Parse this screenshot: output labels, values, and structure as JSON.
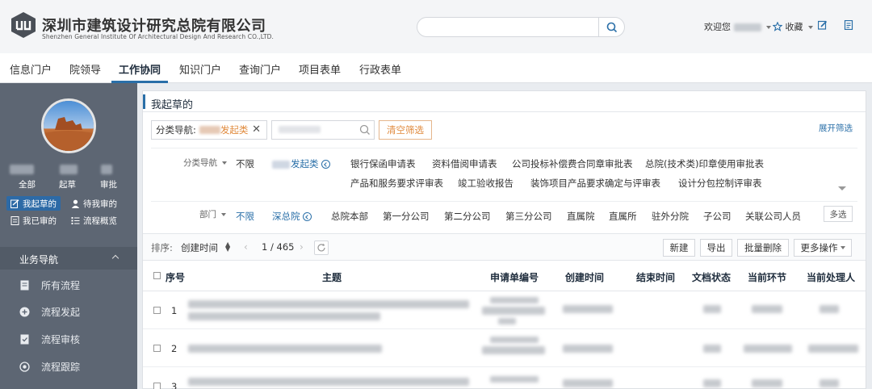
{
  "header": {
    "org_name_cn": "深圳市建筑设计研究总院有限公司",
    "org_name_en": "Shenzhen General Institute Of Architectural Design And Research CO.,LTD.",
    "welcome": "欢迎您",
    "favorites": "收藏"
  },
  "nav": {
    "items": [
      "信息门户",
      "院领导",
      "工作协同",
      "知识门户",
      "查询门户",
      "项目表单",
      "行政表单"
    ],
    "active": "工作协同"
  },
  "sidebar": {
    "stats": [
      {
        "label": "全部"
      },
      {
        "label": "起草"
      },
      {
        "label": "审批"
      }
    ],
    "quick": [
      {
        "label": "我起草的",
        "active": true
      },
      {
        "label": "待我审的",
        "active": false
      },
      {
        "label": "我已审的",
        "active": false
      },
      {
        "label": "流程概览",
        "active": false
      }
    ],
    "biz_nav_title": "业务导航",
    "items": [
      "所有流程",
      "流程发起",
      "流程审核",
      "流程跟踪"
    ]
  },
  "panel": {
    "title": "我起草的",
    "filter": {
      "chip_prefix": "分类导航:",
      "chip_value": "发起类",
      "clear_label": "清空筛选",
      "expand_label": "展开筛选"
    },
    "category": {
      "label": "分类导航",
      "unlimited": "不限",
      "selected": "发起类",
      "row1": [
        "银行保函申请表",
        "资料借阅申请表",
        "公司投标补偿费合同章审批表",
        "总院(技术类)印章使用审批表"
      ],
      "row2": [
        "产品和服务要求评审表",
        "竣工验收报告",
        "装饰项目产品要求确定与评审表",
        "设计分包控制评审表"
      ]
    },
    "department": {
      "label": "部门",
      "unlimited": "不限",
      "selected": "深总院",
      "items": [
        "总院本部",
        "第一分公司",
        "第二分公司",
        "第三分公司",
        "直属院",
        "直属所",
        "驻外分院",
        "子公司",
        "关联公司人员"
      ],
      "multi_label": "多选"
    },
    "toolbar": {
      "sort_label": "排序:",
      "sort_value": "创建时间",
      "page": "1 / 465",
      "buttons": [
        "新建",
        "导出",
        "批量删除",
        "更多操作"
      ]
    },
    "table": {
      "columns": [
        "序号",
        "主题",
        "申请单编号",
        "创建时间",
        "结束时间",
        "文档状态",
        "当前环节",
        "当前处理人"
      ],
      "rows": [
        {
          "index": "1"
        },
        {
          "index": "2"
        },
        {
          "index": "3"
        }
      ]
    }
  }
}
